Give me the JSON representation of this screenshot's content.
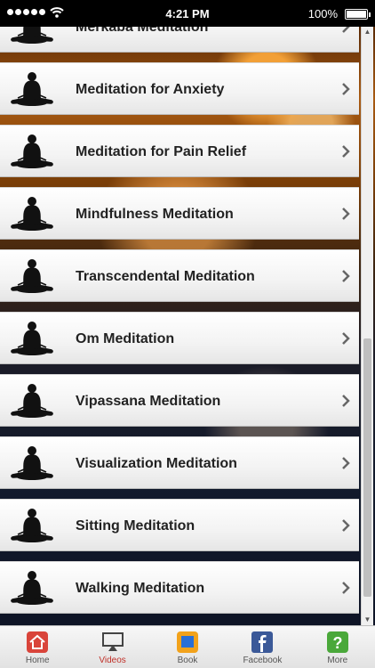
{
  "status_bar": {
    "time": "4:21 PM",
    "battery": "100%"
  },
  "list": {
    "items": [
      {
        "label": "Merkaba Meditation"
      },
      {
        "label": "Meditation for Anxiety"
      },
      {
        "label": "Meditation for Pain Relief"
      },
      {
        "label": "Mindfulness Meditation"
      },
      {
        "label": "Transcendental Meditation"
      },
      {
        "label": "Om Meditation"
      },
      {
        "label": "Vipassana Meditation"
      },
      {
        "label": "Visualization Meditation"
      },
      {
        "label": "Sitting Meditation"
      },
      {
        "label": "Walking Meditation"
      }
    ]
  },
  "tabs": [
    {
      "label": "Home",
      "icon": "home-icon",
      "color": "#d9443a"
    },
    {
      "label": "Videos",
      "icon": "airplay-icon",
      "color": "#444444",
      "active": true
    },
    {
      "label": "Book",
      "icon": "book-icon",
      "color": "#f2a21b"
    },
    {
      "label": "Facebook",
      "icon": "facebook-icon",
      "color": "#3b5998"
    },
    {
      "label": "More",
      "icon": "more-icon",
      "color": "#4aa83a"
    }
  ]
}
